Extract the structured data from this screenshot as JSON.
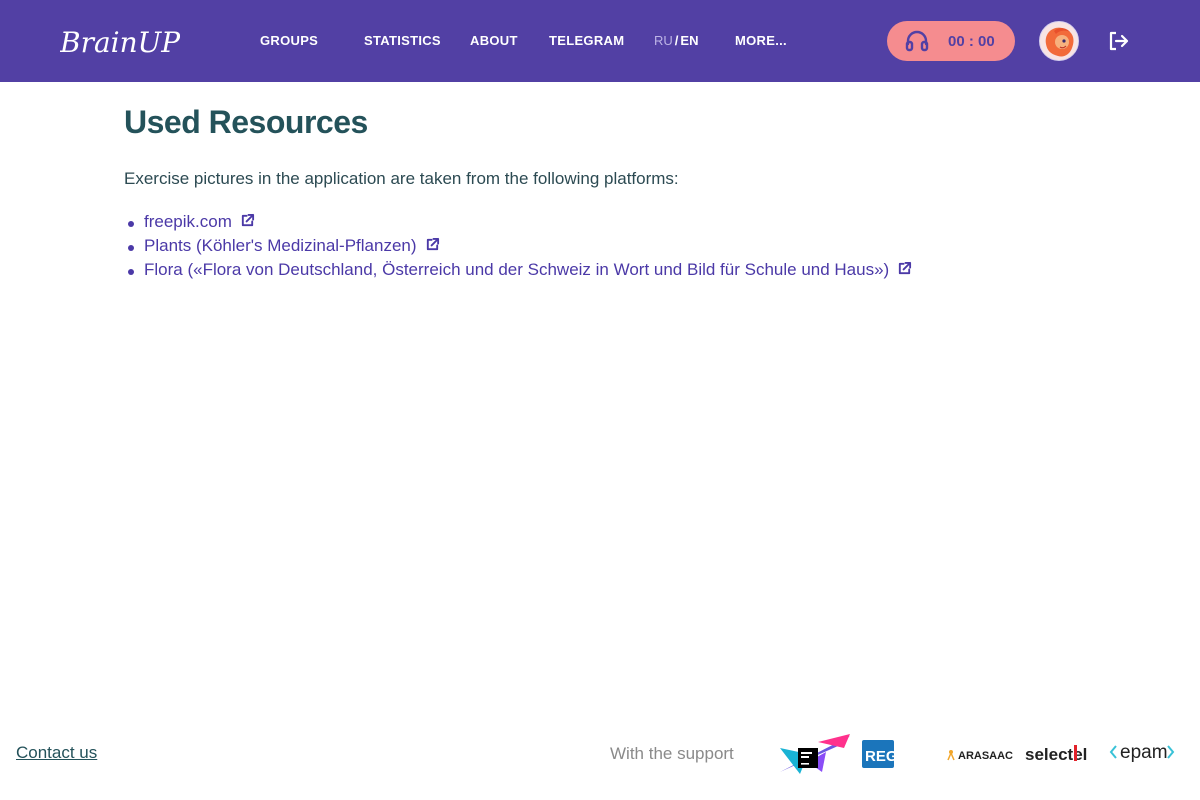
{
  "header": {
    "logo_text": "BrainUP",
    "nav": [
      {
        "label": "GROUPS"
      },
      {
        "label": "STATISTICS"
      },
      {
        "label": "ABOUT"
      },
      {
        "label": "TELEGRAM"
      },
      {
        "label": "MORE..."
      }
    ],
    "lang": {
      "inactive": "RU",
      "separator": "/",
      "active": "EN"
    },
    "timer": {
      "value": "00 : 00",
      "icon": "headphones-icon"
    },
    "avatar": {
      "icon": "avatar-image"
    },
    "logout": {
      "icon": "logout-icon"
    }
  },
  "main": {
    "title": "Used Resources",
    "intro": "Exercise pictures in the application are taken from the following platforms:",
    "resources": [
      {
        "label": "freepik.com"
      },
      {
        "label": "Plants (Köhler's Medizinal-Pflanzen)"
      },
      {
        "label": "Flora («Flora von Deutschland, Österreich und der Schweiz in Wort und Bild für Schule und Haus»)"
      }
    ]
  },
  "footer": {
    "contact": "Contact us",
    "support": "With the support",
    "sponsors": [
      {
        "name": "JetBrains",
        "icon": "jetbrains-logo"
      },
      {
        "name": "REG.RU",
        "text": "REG.RU"
      },
      {
        "name": "ARASAAC",
        "text": "ARASAAC"
      },
      {
        "name": "Selectel",
        "text": "selectel"
      },
      {
        "name": "EPAM",
        "text": "epam"
      }
    ]
  },
  "colors": {
    "header_bg": "#5240a4",
    "timer_bg": "#f58c8f",
    "title": "#24525a",
    "link": "#4b39a7"
  }
}
